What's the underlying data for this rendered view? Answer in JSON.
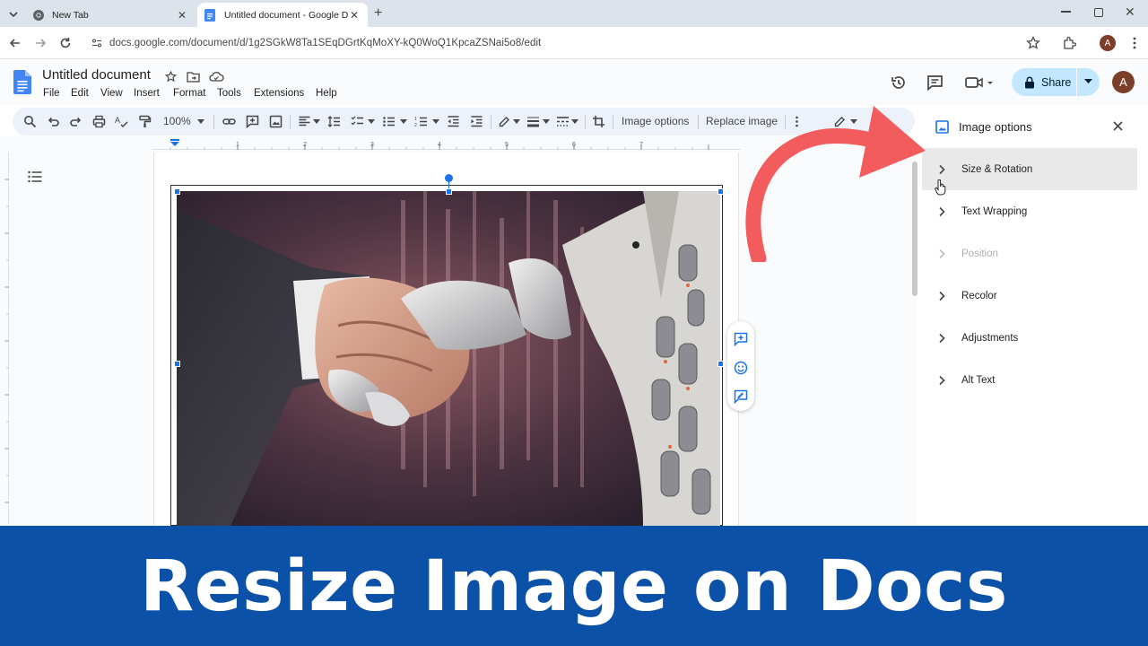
{
  "browser": {
    "tabs": [
      {
        "title": "New Tab",
        "active": false
      },
      {
        "title": "Untitled document - Google D",
        "active": true
      }
    ],
    "url": "docs.google.com/document/d/1g2SGkW8Ta1SEqDGrtKqMoXY-kQ0WoQ1KpcaZSNai5o8/edit",
    "profile_initial": "A"
  },
  "docs": {
    "title": "Untitled document",
    "menu": [
      "File",
      "Edit",
      "View",
      "Insert",
      "Format",
      "Tools",
      "Extensions",
      "Help"
    ],
    "share_label": "Share",
    "avatar_initial": "A",
    "toolbar": {
      "zoom": "100%",
      "image_options": "Image options",
      "replace_image": "Replace image"
    }
  },
  "panel": {
    "title": "Image options",
    "options": [
      {
        "label": "Size & Rotation",
        "state": "hover"
      },
      {
        "label": "Text Wrapping",
        "state": "normal"
      },
      {
        "label": "Position",
        "state": "disabled"
      },
      {
        "label": "Recolor",
        "state": "normal"
      },
      {
        "label": "Adjustments",
        "state": "normal"
      },
      {
        "label": "Alt Text",
        "state": "normal"
      }
    ]
  },
  "banner": {
    "text": "Resize Image on Docs"
  },
  "colors": {
    "banner_bg": "#0b51a8",
    "arrow": "#f25c5c",
    "share_bg": "#c2e7ff",
    "selection_blue": "#1a73e8"
  }
}
